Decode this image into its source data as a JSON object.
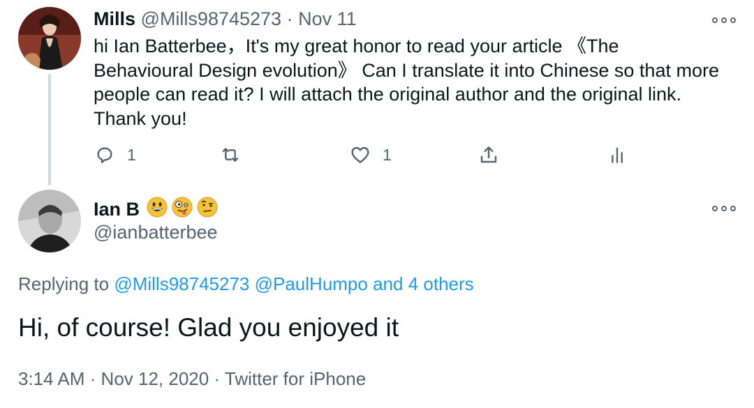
{
  "tweet": {
    "author_name": "Mills",
    "author_handle": "@Mills98745273",
    "separator": "·",
    "date": "Nov 11",
    "body_lines": [
      "hi Ian Batterbee，It's my great honor to read your article 《The",
      "Behavioural Design evolution》 Can I translate it into Chinese so that more",
      "people can read it?  I will attach the original author and the original link.",
      "Thank you!"
    ],
    "reply_count": "1",
    "like_count": "1"
  },
  "reply": {
    "author_name": "Ian B",
    "author_handle": "@ianbatterbee",
    "emojis": [
      "grinning-face-emoji",
      "zany-face-emoji",
      "face-with-raised-eyebrow-emoji"
    ],
    "replying_prefix": "Replying to",
    "replying_to": [
      "@Mills98745273",
      "@PaulHumpo"
    ],
    "replying_others": "and 4 others",
    "text": "Hi, of course! Glad you enjoyed it",
    "time": "3:14 AM",
    "date": "Nov 12, 2020",
    "source": "Twitter for iPhone",
    "separator": "·"
  },
  "colors": {
    "text": "#0f1419",
    "muted": "#536471",
    "link": "#1d9bf0",
    "thread_line": "#cfd9de"
  },
  "icons": [
    "more-icon",
    "reply-icon",
    "retweet-icon",
    "like-icon",
    "share-icon",
    "analytics-icon"
  ]
}
